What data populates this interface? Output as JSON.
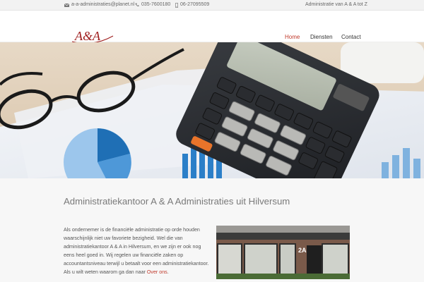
{
  "topbar": {
    "email": "a-a-administraties@planet.nl",
    "phone": "035-7600180",
    "mobile": "06-27095509",
    "tagline": "Administratie van A & A tot Z"
  },
  "header": {
    "logo_text": "A&A",
    "logo_subtext": "administraties",
    "nav": [
      {
        "label": "Home",
        "active": true
      },
      {
        "label": "Diensten",
        "active": false
      },
      {
        "label": "Contact",
        "active": false
      }
    ]
  },
  "hero": {
    "calculator_keys": [
      "%",
      "MU",
      "÷",
      "M+",
      "×",
      "M-",
      "-",
      "MR",
      "7",
      "8",
      "9",
      "+",
      "MC",
      "4",
      "5",
      "6",
      "+/-",
      "1",
      "2",
      "3",
      "▶",
      "0",
      "00",
      "·",
      "ON/CA"
    ]
  },
  "main": {
    "title": "Administratiekantoor A & A Administraties uit Hilversum",
    "paragraph_text": "Als ondernemer is de financiële administratie op orde houden waarschijnlijk niet uw favoriete bezigheid. Wel die van administratiekantoor A & A in Hilversum, en we zijn er ook nog eens heel goed in. Wij regelen uw financiële zaken op accountantsniveau terwijl u betaalt voor een administratiekantoor. Als u wilt weten waarom ga dan naar ",
    "paragraph_link": "Over ons",
    "paragraph_end": ".",
    "photo_sign": "2A"
  },
  "colors": {
    "accent": "#c0392b",
    "topbar_bg": "#f2f2f2",
    "content_bg": "#f7f7f7"
  },
  "icons": {
    "email": "envelope-icon",
    "phone": "phone-icon",
    "mobile": "mobile-icon"
  }
}
